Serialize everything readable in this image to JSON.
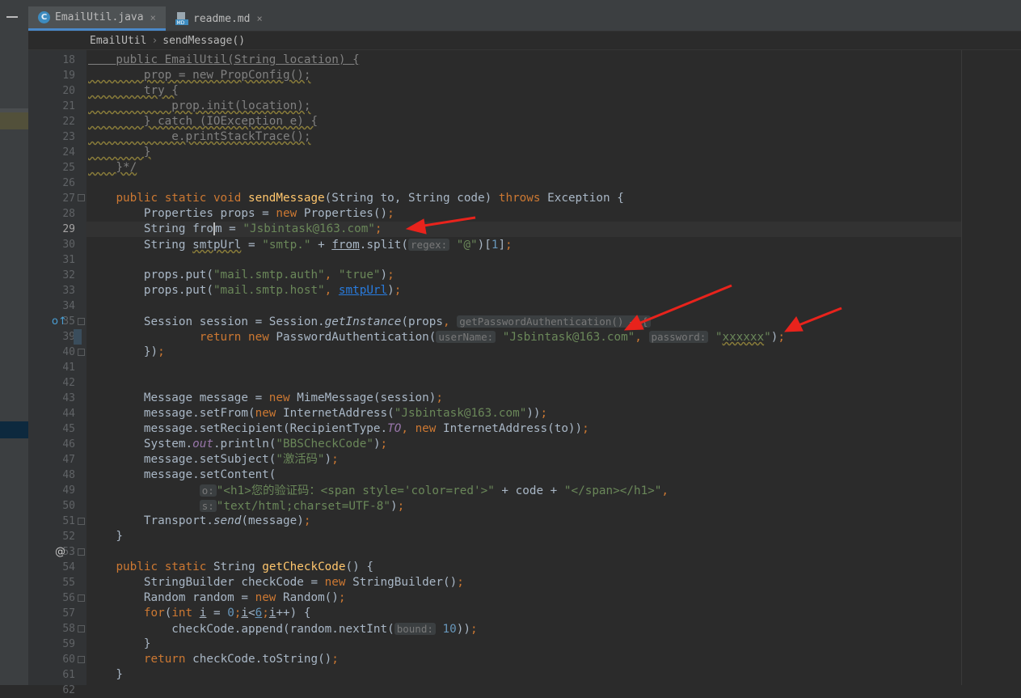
{
  "tabs": [
    {
      "label": "EmailUtil.java",
      "icon": "java-class-icon",
      "active": true
    },
    {
      "label": "readme.md",
      "icon": "markdown-file-icon",
      "active": false
    }
  ],
  "tab_close_glyph": "×",
  "breadcrumb": {
    "class_name": "EmailUtil",
    "separator": "›",
    "method": "sendMessage()"
  },
  "gutter_icons": {
    "line35": "o↑",
    "line54": "@"
  },
  "colors": {
    "keyword": "#cc7832",
    "string": "#6a8759",
    "number": "#6897bb",
    "method": "#ffc66d",
    "field": "#9876aa",
    "comment": "#808080",
    "text": "#a9b7c6",
    "arrow": "#e8231c"
  },
  "lines": [
    {
      "n": "18",
      "t": [
        [
          "    public EmailUtil(String location) {",
          "cmt ul"
        ]
      ]
    },
    {
      "n": "19",
      "t": [
        [
          "        prop = new PropConfig();",
          "cmt wavy"
        ]
      ]
    },
    {
      "n": "20",
      "t": [
        [
          "        try {",
          "cmt wavy"
        ]
      ]
    },
    {
      "n": "21",
      "t": [
        [
          "            prop.init(location);",
          "cmt wavy"
        ]
      ]
    },
    {
      "n": "22",
      "t": [
        [
          "        } catch (IOException e) {",
          "cmt wavy"
        ]
      ]
    },
    {
      "n": "23",
      "t": [
        [
          "            e.printStackTrace();",
          "cmt wavy"
        ]
      ]
    },
    {
      "n": "24",
      "t": [
        [
          "        }",
          "cmt wavy"
        ]
      ]
    },
    {
      "n": "25",
      "t": [
        [
          "    }*/",
          "cmt wavy"
        ]
      ]
    },
    {
      "n": "26",
      "t": []
    },
    {
      "n": "27",
      "t": [
        [
          "    ",
          ""
        ],
        [
          "public static void ",
          "kw"
        ],
        [
          "sendMessage",
          "fn"
        ],
        [
          "(String to, String code) ",
          ""
        ],
        [
          "throws ",
          "kw"
        ],
        [
          "Exception {",
          ""
        ]
      ]
    },
    {
      "n": "28",
      "t": [
        [
          "        Properties props = ",
          ""
        ],
        [
          "new ",
          "kw"
        ],
        [
          "Properties()",
          ""
        ],
        [
          ";",
          "kw"
        ]
      ]
    },
    {
      "n": "29",
      "t": [
        [
          "        String fro",
          ""
        ],
        [
          "m",
          "caret"
        ],
        [
          " = ",
          ""
        ],
        [
          "\"Jsbintask@163.com\"",
          "str"
        ],
        [
          ";",
          "kw"
        ]
      ]
    },
    {
      "n": "30",
      "t": [
        [
          "        String ",
          ""
        ],
        [
          "smtpUrl",
          "wavy"
        ],
        [
          " = ",
          ""
        ],
        [
          "\"smtp.\"",
          "str"
        ],
        [
          " + ",
          ""
        ],
        [
          "from",
          "ul"
        ],
        [
          ".split(",
          ""
        ],
        [
          "regex:",
          "hint"
        ],
        [
          " ",
          ""
        ],
        [
          "\"@\"",
          "str"
        ],
        [
          ")[",
          ""
        ],
        [
          "1",
          "num"
        ],
        [
          "]",
          ""
        ],
        [
          ";",
          "kw"
        ]
      ]
    },
    {
      "n": "31",
      "t": []
    },
    {
      "n": "32",
      "t": [
        [
          "        props.put(",
          ""
        ],
        [
          "\"mail.smtp.auth\"",
          "str"
        ],
        [
          ", ",
          "kw"
        ],
        [
          "\"true\"",
          "str"
        ],
        [
          ")",
          ""
        ],
        [
          ";",
          "kw"
        ]
      ]
    },
    {
      "n": "33",
      "t": [
        [
          "        props.put(",
          ""
        ],
        [
          "\"mail.smtp.host\"",
          "str"
        ],
        [
          ", ",
          "kw"
        ],
        [
          "smtpUrl",
          "link"
        ],
        [
          ")",
          ""
        ],
        [
          ";",
          "kw"
        ]
      ]
    },
    {
      "n": "34",
      "t": []
    },
    {
      "n": "35",
      "t": [
        [
          "        Session session = Session.",
          ""
        ],
        [
          "getInstance",
          "it"
        ],
        [
          "(props",
          ""
        ],
        [
          ", ",
          "kw"
        ],
        [
          "getPasswordAuthentication() → {",
          "hint"
        ]
      ]
    },
    {
      "n": "39",
      "t": [
        [
          "                ",
          ""
        ],
        [
          "return new ",
          "kw"
        ],
        [
          "PasswordAuthentication(",
          ""
        ],
        [
          "userName:",
          "hint"
        ],
        [
          " ",
          ""
        ],
        [
          "\"Jsbintask@163.com\"",
          "str"
        ],
        [
          ", ",
          "kw"
        ],
        [
          "password:",
          "hint"
        ],
        [
          " ",
          ""
        ],
        [
          "\"",
          "str"
        ],
        [
          "xxxxxx",
          "str wavy"
        ],
        [
          "\"",
          "str"
        ],
        [
          ")",
          ""
        ],
        [
          ";",
          "kw"
        ]
      ]
    },
    {
      "n": "40",
      "t": [
        [
          "        })",
          ""
        ],
        [
          ";",
          "kw"
        ]
      ]
    },
    {
      "n": "41",
      "t": []
    },
    {
      "n": "42",
      "t": []
    },
    {
      "n": "43",
      "t": [
        [
          "        Message message = ",
          ""
        ],
        [
          "new ",
          "kw"
        ],
        [
          "MimeMessage(session)",
          ""
        ],
        [
          ";",
          "kw"
        ]
      ]
    },
    {
      "n": "44",
      "t": [
        [
          "        message.setFrom(",
          ""
        ],
        [
          "new ",
          "kw"
        ],
        [
          "InternetAddress(",
          ""
        ],
        [
          "\"Jsbintask@163.com\"",
          "str"
        ],
        [
          "))",
          ""
        ],
        [
          ";",
          "kw"
        ]
      ]
    },
    {
      "n": "45",
      "t": [
        [
          "        message.setRecipient(RecipientType.",
          ""
        ],
        [
          "TO",
          "field it"
        ],
        [
          ", ",
          "kw"
        ],
        [
          "new ",
          "kw"
        ],
        [
          "InternetAddress(to))",
          ""
        ],
        [
          ";",
          "kw"
        ]
      ]
    },
    {
      "n": "46",
      "t": [
        [
          "        System.",
          ""
        ],
        [
          "out",
          "field it"
        ],
        [
          ".println(",
          ""
        ],
        [
          "\"BBSCheckCode\"",
          "str"
        ],
        [
          ")",
          ""
        ],
        [
          ";",
          "kw"
        ]
      ]
    },
    {
      "n": "47",
      "t": [
        [
          "        message.setSubject(",
          ""
        ],
        [
          "\"激活码\"",
          "str"
        ],
        [
          ")",
          ""
        ],
        [
          ";",
          "kw"
        ]
      ]
    },
    {
      "n": "48",
      "t": [
        [
          "        message.setContent(",
          ""
        ]
      ]
    },
    {
      "n": "49",
      "t": [
        [
          "                ",
          ""
        ],
        [
          "o:",
          "hint"
        ],
        [
          "\"<h1>您的验证码：<span style='color=red'>\"",
          "str"
        ],
        [
          " + code + ",
          ""
        ],
        [
          "\"</span></h1>\"",
          "str"
        ],
        [
          ",",
          "kw"
        ]
      ]
    },
    {
      "n": "50",
      "t": [
        [
          "                ",
          ""
        ],
        [
          "s:",
          "hint"
        ],
        [
          "\"text/html;charset=UTF-8\"",
          "str"
        ],
        [
          ")",
          ""
        ],
        [
          ";",
          "kw"
        ]
      ]
    },
    {
      "n": "51",
      "t": [
        [
          "        Transport.",
          ""
        ],
        [
          "send",
          "it"
        ],
        [
          "(message)",
          ""
        ],
        [
          ";",
          "kw"
        ]
      ]
    },
    {
      "n": "52",
      "t": [
        [
          "    }",
          ""
        ]
      ]
    },
    {
      "n": "53",
      "t": []
    },
    {
      "n": "54",
      "t": [
        [
          "    ",
          ""
        ],
        [
          "public static ",
          "kw"
        ],
        [
          "String ",
          ""
        ],
        [
          "getCheckCode",
          "fn"
        ],
        [
          "() {",
          ""
        ]
      ]
    },
    {
      "n": "55",
      "t": [
        [
          "        StringBuilder checkCode = ",
          ""
        ],
        [
          "new ",
          "kw"
        ],
        [
          "StringBuilder()",
          ""
        ],
        [
          ";",
          "kw"
        ]
      ]
    },
    {
      "n": "56",
      "t": [
        [
          "        Random random = ",
          ""
        ],
        [
          "new ",
          "kw"
        ],
        [
          "Random()",
          ""
        ],
        [
          ";",
          "kw"
        ]
      ]
    },
    {
      "n": "57",
      "t": [
        [
          "        ",
          ""
        ],
        [
          "for",
          "kw"
        ],
        [
          "(",
          ""
        ],
        [
          "int ",
          "kw"
        ],
        [
          "i",
          "ul"
        ],
        [
          " = ",
          ""
        ],
        [
          "0",
          "num"
        ],
        [
          ";",
          "kw"
        ],
        [
          "i",
          "ul"
        ],
        [
          "<",
          ""
        ],
        [
          "6",
          "num ul"
        ],
        [
          ";",
          "kw"
        ],
        [
          "i",
          "ul"
        ],
        [
          "++) {",
          ""
        ]
      ]
    },
    {
      "n": "58",
      "t": [
        [
          "            checkCode.append(random.nextInt(",
          ""
        ],
        [
          "bound:",
          "hint"
        ],
        [
          " ",
          ""
        ],
        [
          "10",
          "num"
        ],
        [
          "))",
          ""
        ],
        [
          ";",
          "kw"
        ]
      ]
    },
    {
      "n": "59",
      "t": [
        [
          "        }",
          ""
        ]
      ]
    },
    {
      "n": "60",
      "t": [
        [
          "        ",
          ""
        ],
        [
          "return ",
          "kw"
        ],
        [
          "checkCode.toString()",
          ""
        ],
        [
          ";",
          "kw"
        ]
      ]
    },
    {
      "n": "61",
      "t": [
        [
          "    }",
          ""
        ]
      ]
    },
    {
      "n": "62",
      "t": []
    }
  ]
}
